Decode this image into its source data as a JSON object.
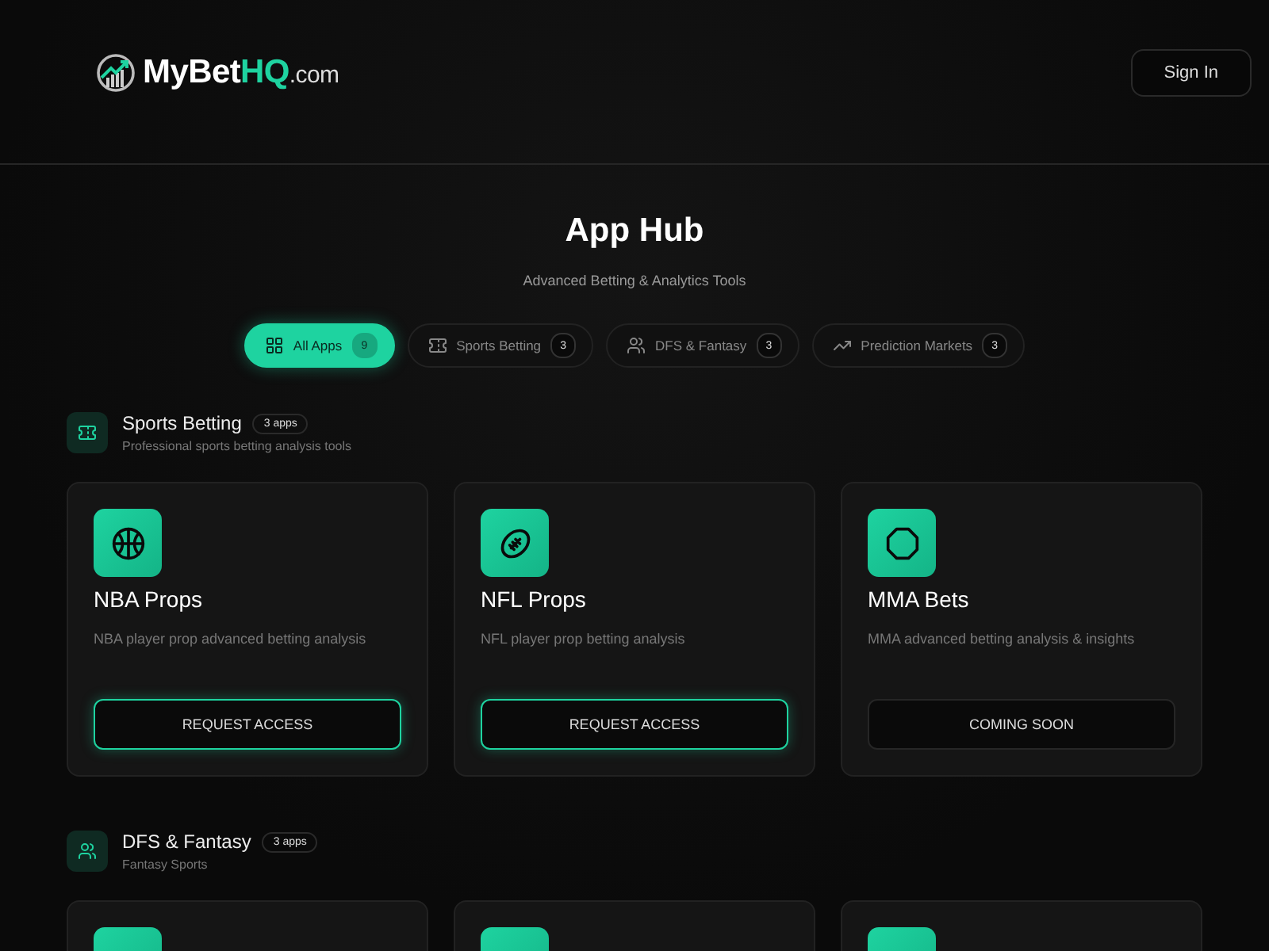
{
  "header": {
    "logo": {
      "name": "MyBet",
      "accent": "HQ",
      "suffix": ".com"
    },
    "sign_in": "Sign In"
  },
  "hero": {
    "title": "App Hub",
    "subtitle": "Advanced Betting & Analytics Tools"
  },
  "filters": [
    {
      "label": "All Apps",
      "count": "9",
      "kind": "grid",
      "selected": true
    },
    {
      "label": "Sports Betting",
      "count": "3",
      "kind": "ticket",
      "selected": false
    },
    {
      "label": "DFS & Fantasy",
      "count": "3",
      "kind": "users",
      "selected": false
    },
    {
      "label": "Prediction Markets",
      "count": "3",
      "kind": "trend",
      "selected": false
    }
  ],
  "sections": [
    {
      "title": "Sports Betting",
      "badge": "3 apps",
      "subtitle": "Professional sports betting analysis tools",
      "kind": "ticket",
      "apps": [
        {
          "title": "NBA Props",
          "description": "NBA player prop advanced betting analysis",
          "kind": "basketball",
          "action": {
            "kind": "request",
            "label": "REQUEST ACCESS"
          }
        },
        {
          "title": "NFL Props",
          "description": "NFL player prop betting analysis",
          "kind": "football",
          "action": {
            "kind": "request",
            "label": "REQUEST ACCESS"
          }
        },
        {
          "title": "MMA Bets",
          "description": "MMA advanced betting analysis & insights",
          "kind": "octagon",
          "action": {
            "kind": "soon",
            "label": "COMING SOON"
          }
        }
      ]
    },
    {
      "title": "DFS & Fantasy",
      "badge": "3 apps",
      "subtitle": "Fantasy Sports",
      "kind": "users",
      "apps": [
        {
          "kind": "tile"
        },
        {
          "kind": "tile"
        },
        {
          "kind": "tile"
        }
      ]
    }
  ]
}
